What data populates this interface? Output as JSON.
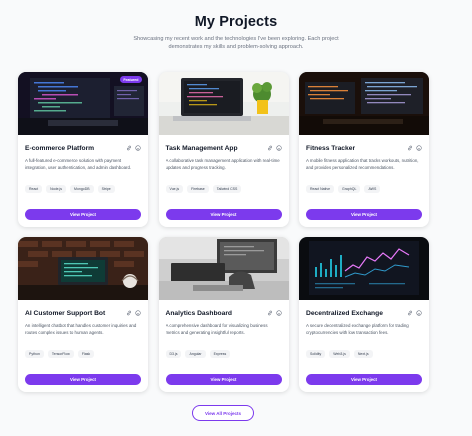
{
  "header": {
    "title": "My Projects",
    "subtitle": "Showcasing my recent work and the technologies I've been exploring. Each project demonstrates my skills and problem-solving approach."
  },
  "projects": [
    {
      "title": "E-commerce Platform",
      "badge": "Featured",
      "description": "A full-featured e-commerce solution with payment integration, user authentication, and admin dashboard.",
      "tags": [
        "React",
        "Node.js",
        "MongoDB",
        "Stripe"
      ],
      "button": "View Project",
      "image": "laptop-code-dark"
    },
    {
      "title": "Task Management App",
      "badge": "",
      "description": "A collaborative task management application with real-time updates and progress tracking.",
      "tags": [
        "Vue.js",
        "Firebase",
        "Tailwind CSS"
      ],
      "button": "View Project",
      "image": "laptop-desk-plant"
    },
    {
      "title": "Fitness Tracker",
      "badge": "",
      "description": "A mobile fitness application that tracks workouts, nutrition, and provides personalized recommendations.",
      "tags": [
        "React Native",
        "GraphQL",
        "AWS"
      ],
      "button": "View Project",
      "image": "monitors-night"
    },
    {
      "title": "AI Customer Support Bot",
      "badge": "",
      "description": "An intelligent chatbot that handles customer inquiries and routes complex issues to human agents.",
      "tags": [
        "Python",
        "TensorFlow",
        "Flask"
      ],
      "button": "View Project",
      "image": "laptop-brick-wall"
    },
    {
      "title": "Analytics Dashboard",
      "badge": "",
      "description": "A comprehensive dashboard for visualizing business metrics and generating insightful reports.",
      "tags": [
        "D3.js",
        "Angular",
        "Express"
      ],
      "button": "View Project",
      "image": "laptop-grayscale"
    },
    {
      "title": "Decentralized Exchange",
      "badge": "",
      "description": "A secure decentralized exchange platform for trading cryptocurrencies with low transaction fees.",
      "tags": [
        "Solidity",
        "Web3.js",
        "Next.js"
      ],
      "button": "View Project",
      "image": "trading-chart-screen"
    }
  ],
  "icons": {
    "link": "link-icon",
    "code": "github-icon"
  },
  "footer": {
    "view_all_label": "View All Projects"
  },
  "colors": {
    "accent": "#7c3aed",
    "text": "#111827",
    "muted": "#6b7280",
    "background": "#f9fafb"
  }
}
